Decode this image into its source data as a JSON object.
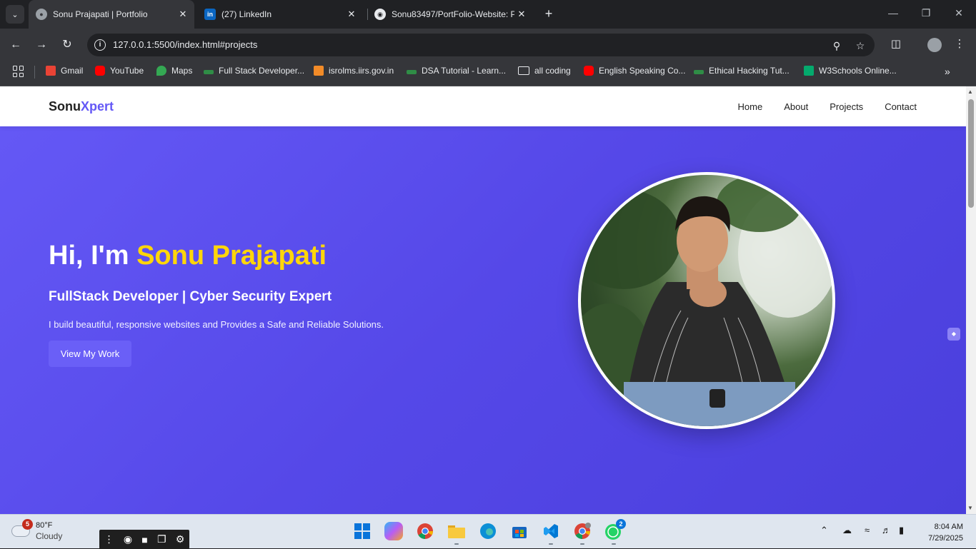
{
  "browser": {
    "tabs": [
      {
        "title": "Sonu Prajapati | Portfolio",
        "favicon": "globe-icon",
        "active": true
      },
      {
        "title": "(27) LinkedIn",
        "favicon": "linkedin-icon",
        "active": false
      },
      {
        "title": "Sonu83497/PortFolio-Website: P",
        "favicon": "github-icon",
        "active": false
      }
    ],
    "new_tab_label": "+",
    "url": "127.0.0.1:5500/index.html#projects",
    "bookmarks": [
      {
        "label": "Gmail",
        "color": "#ea4335"
      },
      {
        "label": "YouTube",
        "color": "#ff0000"
      },
      {
        "label": "Maps",
        "color": "#34a853"
      },
      {
        "label": "Full Stack Developer...",
        "color": "#2f8d46"
      },
      {
        "label": "isrolms.iirs.gov.in",
        "color": "#f28b28"
      },
      {
        "label": "DSA Tutorial - Learn...",
        "color": "#2f8d46"
      },
      {
        "label": "all coding",
        "color": "#e8eaed"
      },
      {
        "label": "English Speaking Co...",
        "color": "#ff0000"
      },
      {
        "label": "Ethical Hacking Tut...",
        "color": "#2f8d46"
      },
      {
        "label": "W3Schools Online...",
        "color": "#04aa6d"
      }
    ]
  },
  "site": {
    "logo_part1": "Sonu",
    "logo_part2": "Xpert",
    "accent_color": "#6458f6",
    "nav": [
      "Home",
      "About",
      "Projects",
      "Contact"
    ],
    "hero": {
      "greeting": "Hi, I'm ",
      "name": "Sonu Prajapati",
      "subtitle": "FullStack Developer | Cyber Security Expert",
      "description": "I build beautiful, responsive websites and Provides a Safe and Reliable Solutions.",
      "button": "View My Work"
    }
  },
  "taskbar": {
    "weather_temp": "80°F",
    "weather_desc": "Cloudy",
    "weather_badge": "5",
    "whatsapp_badge": "2",
    "time": "8:04 AM",
    "date": "7/29/2025"
  }
}
